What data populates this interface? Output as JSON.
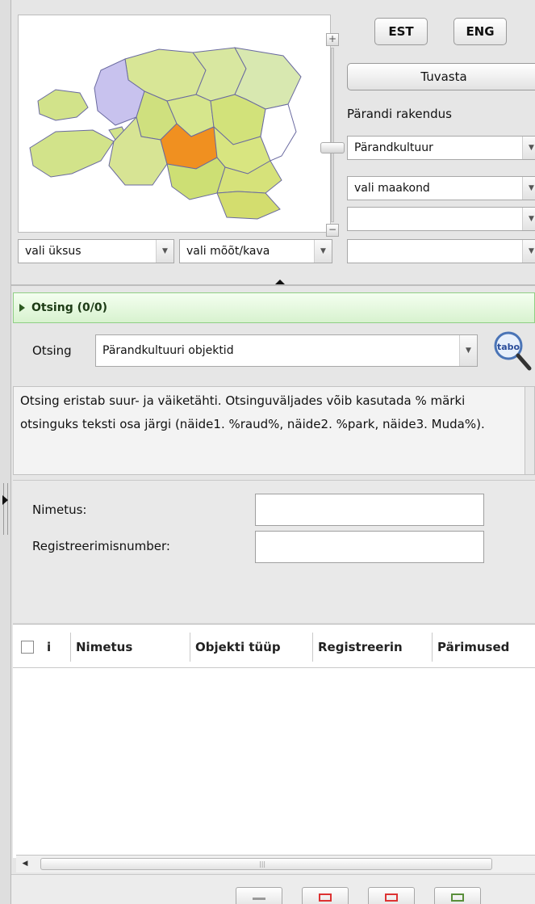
{
  "language_buttons": [
    "EST",
    "ENG"
  ],
  "tuvasta_label": "Tuvasta",
  "rp_label": "Pärandi rakendus",
  "rp_combos": [
    "Pärandkultuur",
    "vali maakond",
    "",
    ""
  ],
  "map_combos": [
    "vali üksus",
    "vali mõõt/kava"
  ],
  "search_header": "Otsing (0/0)",
  "otsing_label": "Otsing",
  "otsing_value": "Pärandkultuuri objektid",
  "search_button_icon": "tabo-magnifier-icon",
  "description": "Otsing eristab suur- ja väiketähti. Otsinguväljades võib kasutada % märki otsinguks teksti osa järgi (näide1. %raud%, näide2. %park, näide3. Muda%).",
  "form": {
    "name_label": "Nimetus:",
    "regnum_label": "Registreerimisnumber:",
    "name_value": "",
    "regnum_value": ""
  },
  "grid_columns": [
    "i",
    "Nimetus",
    "Objekti tüüp",
    "Registreerin",
    "Pärimused"
  ],
  "grid_rows": [],
  "colors": {
    "header_green": "#d8f2cf",
    "region_highlight": "#f09020",
    "region_purple": "#c8c2ee",
    "region_green": "#d2e38a"
  }
}
